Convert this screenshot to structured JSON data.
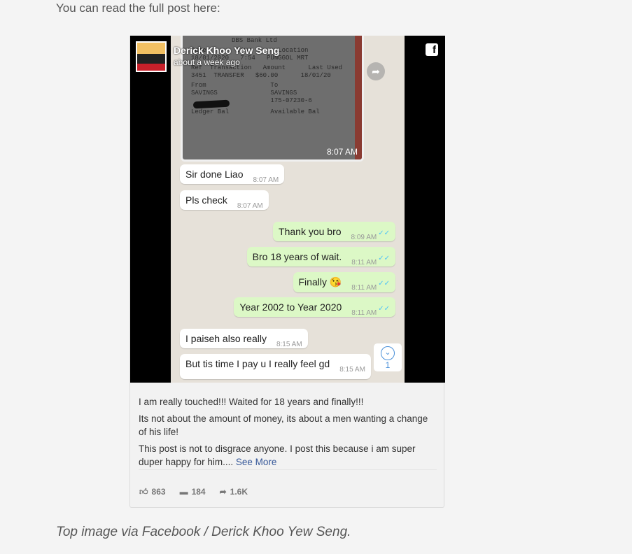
{
  "intro": "You can read the full post here:",
  "post": {
    "author": "Derick Khoo Yew Seng",
    "time": "about a week ago",
    "receipt": {
      "lines": [
        "DBS Bank Ltd",
        "Date        Time       Location",
        "18/01/2020   7:54   PUNGGOL MRT",
        "Ref  Transaction   Amount      Last Used",
        "3451  TRANSFER   $60.00      18/01/20",
        "From                 To",
        "SAVINGS              SAVINGS",
        "                     175-07230-6",
        "Ledger Bal           Available Bal"
      ],
      "time": "8:07 AM"
    },
    "messages": [
      {
        "dir": "in",
        "text": "Sir done Liao",
        "time": "8:07 AM"
      },
      {
        "dir": "in",
        "text": "Pls check",
        "time": "8:07 AM"
      },
      {
        "dir": "out",
        "text": "Thank you bro",
        "time": "8:09 AM"
      },
      {
        "dir": "out",
        "text": "Bro 18 years of wait.",
        "time": "8:11 AM"
      },
      {
        "dir": "out",
        "text": "Finally 😘",
        "time": "8:11 AM"
      },
      {
        "dir": "out",
        "text": "Year 2002 to Year 2020",
        "time": "8:11 AM"
      },
      {
        "dir": "in",
        "text": "I paiseh also really",
        "time": "8:15 AM"
      },
      {
        "dir": "in",
        "text": "But tis time I pay u I really feel gd",
        "time": "8:15 AM"
      }
    ],
    "unread_count": "1",
    "paragraphs": [
      "I am really touched!!! Waited for 18 years and finally!!!",
      "Its not about the amount of money, its about a men wanting a change of his life!",
      "This post is not to disgrace anyone. I post this because i am super duper happy for him...."
    ],
    "see_more": "See More",
    "likes": "863",
    "comments": "184",
    "shares": "1.6K"
  },
  "caption": "Top image via Facebook / Derick Khoo Yew Seng.",
  "colors": {
    "sent_bubble": "#dcf8c6",
    "link": "#365899",
    "read_tick": "#4fc3f7"
  }
}
